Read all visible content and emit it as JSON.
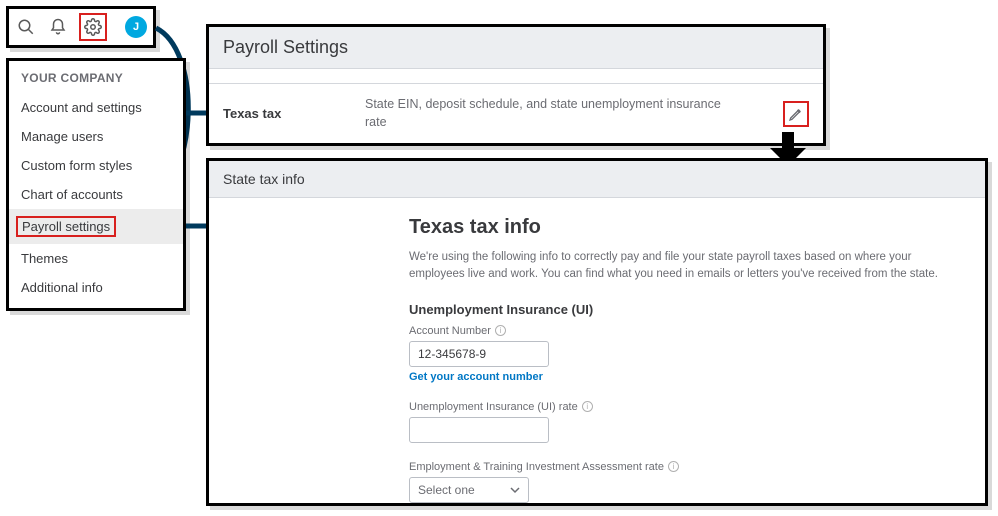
{
  "iconbar": {
    "avatar_initial": "J"
  },
  "company_menu": {
    "heading": "YOUR COMPANY",
    "items": [
      "Account and settings",
      "Manage users",
      "Custom form styles",
      "Chart of accounts",
      "Payroll settings",
      "Themes",
      "Additional info"
    ]
  },
  "payroll_listing": {
    "title": "Payroll Settings",
    "row": {
      "name": "Texas tax",
      "desc": "State EIN, deposit schedule, and state unemployment insurance rate"
    }
  },
  "state_tax": {
    "header": "State tax info",
    "title": "Texas tax info",
    "intro": "We're using the following info to correctly pay and file your state payroll taxes based on where your employees live and work. You can find what you need in emails or letters you've received from the state.",
    "ui_section": "Unemployment Insurance (UI)",
    "account_label": "Account Number",
    "account_value": "12-345678-9",
    "account_link": "Get your account number",
    "rate_label": "Unemployment Insurance (UI) rate",
    "rate_value": "",
    "etia_label": "Employment & Training Investment Assessment rate",
    "etia_select": "Select one"
  }
}
